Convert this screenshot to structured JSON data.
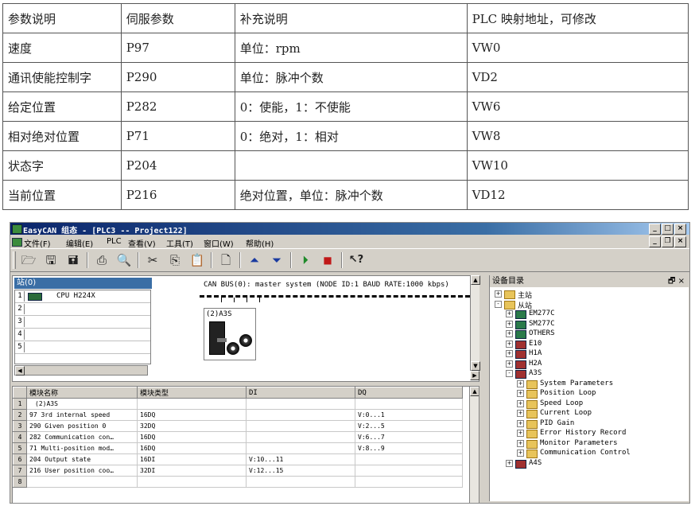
{
  "doc_table": {
    "rows": [
      [
        "参数说明",
        "伺服参数",
        "补充说明",
        "PLC 映射地址，可修改"
      ],
      [
        "速度",
        "P97",
        "单位：rpm",
        "VW0"
      ],
      [
        "通讯使能控制字",
        "P290",
        "单位：脉冲个数",
        "VD2"
      ],
      [
        "给定位置",
        "P282",
        "0：使能，1：不使能",
        "VW6"
      ],
      [
        "相对绝对位置",
        "P71",
        "0：绝对，1：相对",
        "VW8"
      ],
      [
        "状态字",
        "P204",
        "",
        "VW10"
      ],
      [
        "当前位置",
        "P216",
        "绝对位置，单位：脉冲个数",
        "VD12"
      ]
    ]
  },
  "window": {
    "title": "EasyCAN 组态 - [PLC3 -- Project122]",
    "controls": [
      "_",
      "□",
      "×"
    ],
    "mdi_controls": [
      "_",
      "❐",
      "×"
    ]
  },
  "menu": {
    "items": [
      "文件(F)",
      "编辑(E)",
      "PLC",
      "查看(V)",
      "工具(T)",
      "窗口(W)",
      "帮助(H)"
    ]
  },
  "toolbar": {
    "icons": [
      "open-folder-icon",
      "save-icon",
      "save-all-icon",
      "print-icon",
      "print-preview-icon",
      "cut-icon",
      "copy-icon",
      "paste-icon",
      "new-document-icon",
      "upload-icon",
      "download-icon",
      "run-icon",
      "stop-icon",
      "help-pointer-icon"
    ],
    "glyphs": [
      "🗁",
      "🖫",
      "🖬",
      "⎙",
      "🔍",
      "✂",
      "⎘",
      "📋",
      "🗋",
      "⏶",
      "⏷",
      "⏵",
      "■",
      "↖?"
    ]
  },
  "station": {
    "header": "站(0)",
    "slots": [
      {
        "num": "1",
        "name": "CPU H224X"
      },
      {
        "num": "2",
        "name": ""
      },
      {
        "num": "3",
        "name": ""
      },
      {
        "num": "4",
        "name": ""
      },
      {
        "num": "5",
        "name": ""
      }
    ],
    "bus_title": "CAN BUS(0): master system (NODE ID:1 BAUD RATE:1000 kbps)",
    "device_label": "(2)A3S"
  },
  "module_grid": {
    "headers": [
      "模块名称",
      "模块类型",
      "DI",
      "DQ"
    ],
    "rows": [
      {
        "rn": "1",
        "name": "(2)A3S",
        "type": "",
        "di": "",
        "dq": ""
      },
      {
        "rn": "2",
        "name": "97 3rd internal speed",
        "type": "16DQ",
        "di": "",
        "dq": "V:0...1"
      },
      {
        "rn": "3",
        "name": "290 Given position 0",
        "type": "32DQ",
        "di": "",
        "dq": "V:2...5"
      },
      {
        "rn": "4",
        "name": "282 Communication con…",
        "type": "16DQ",
        "di": "",
        "dq": "V:6...7"
      },
      {
        "rn": "5",
        "name": "71 Multi-position mod…",
        "type": "16DQ",
        "di": "",
        "dq": "V:8...9"
      },
      {
        "rn": "6",
        "name": "204 Output state",
        "type": "16DI",
        "di": "V:10...11",
        "dq": ""
      },
      {
        "rn": "7",
        "name": "216 User position coo…",
        "type": "32DI",
        "di": "V:12...15",
        "dq": ""
      },
      {
        "rn": "8",
        "name": "",
        "type": "",
        "di": "",
        "dq": ""
      }
    ]
  },
  "catalog": {
    "title": "设备目录",
    "pin": "🗗 ×",
    "nodes": [
      {
        "label": "主站",
        "level": 0,
        "exp": "+",
        "icon": "folder"
      },
      {
        "label": "从站",
        "level": 0,
        "exp": "-",
        "icon": "folder"
      },
      {
        "label": "EM277C",
        "level": 1,
        "exp": "+",
        "icon": "device"
      },
      {
        "label": "SM277C",
        "level": 1,
        "exp": "+",
        "icon": "device"
      },
      {
        "label": "OTHERS",
        "level": 1,
        "exp": "+",
        "icon": "device"
      },
      {
        "label": "E10",
        "level": 1,
        "exp": "+",
        "icon": "red"
      },
      {
        "label": "H1A",
        "level": 1,
        "exp": "+",
        "icon": "red"
      },
      {
        "label": "H2A",
        "level": 1,
        "exp": "+",
        "icon": "red"
      },
      {
        "label": "A3S",
        "level": 1,
        "exp": "-",
        "icon": "red"
      },
      {
        "label": "System Parameters",
        "level": 2,
        "exp": "+",
        "icon": "folder"
      },
      {
        "label": "Position Loop",
        "level": 2,
        "exp": "+",
        "icon": "folder"
      },
      {
        "label": "Speed Loop",
        "level": 2,
        "exp": "+",
        "icon": "folder"
      },
      {
        "label": "Current Loop",
        "level": 2,
        "exp": "+",
        "icon": "folder"
      },
      {
        "label": "PID Gain",
        "level": 2,
        "exp": "+",
        "icon": "folder"
      },
      {
        "label": "Error History Record",
        "level": 2,
        "exp": "+",
        "icon": "folder"
      },
      {
        "label": "Monitor Parameters",
        "level": 2,
        "exp": "+",
        "icon": "folder"
      },
      {
        "label": "Communication Control",
        "level": 2,
        "exp": "+",
        "icon": "folder"
      },
      {
        "label": "A4S",
        "level": 1,
        "exp": "+",
        "icon": "red"
      }
    ]
  }
}
